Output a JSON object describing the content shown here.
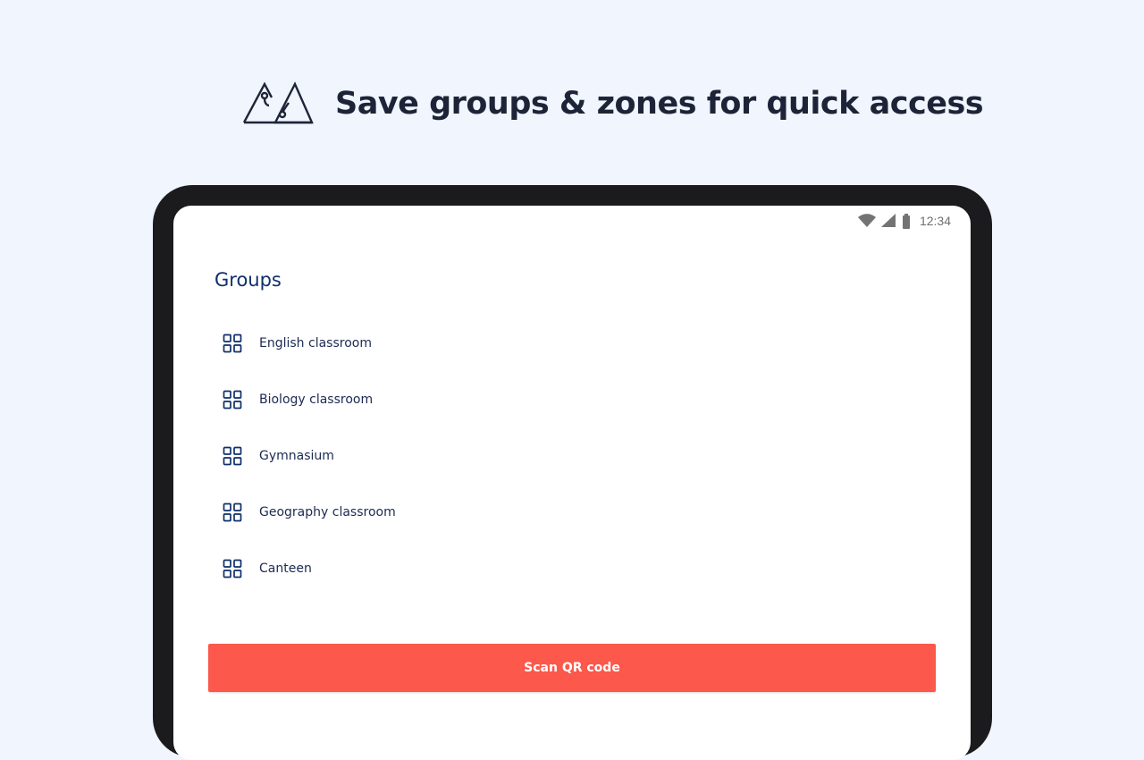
{
  "hero": {
    "title": "Save groups & zones for quick access",
    "logo_icon": "mountain-logo-icon"
  },
  "status_bar": {
    "time": "12:34",
    "icons": [
      "wifi-icon",
      "signal-icon",
      "battery-icon"
    ]
  },
  "groups": {
    "title": "Groups",
    "items": [
      {
        "label": "English classroom",
        "icon": "grid-icon"
      },
      {
        "label": "Biology classroom",
        "icon": "grid-icon"
      },
      {
        "label": "Gymnasium",
        "icon": "grid-icon"
      },
      {
        "label": "Geography classroom",
        "icon": "grid-icon"
      },
      {
        "label": "Canteen",
        "icon": "grid-icon"
      }
    ]
  },
  "actions": {
    "scan_label": "Scan QR code"
  },
  "colors": {
    "background": "#f0f5fe",
    "title_text": "#1e2438",
    "accent_navy": "#0f2f6b",
    "button": "#fc584b",
    "device_frame": "#1b1b1d"
  }
}
